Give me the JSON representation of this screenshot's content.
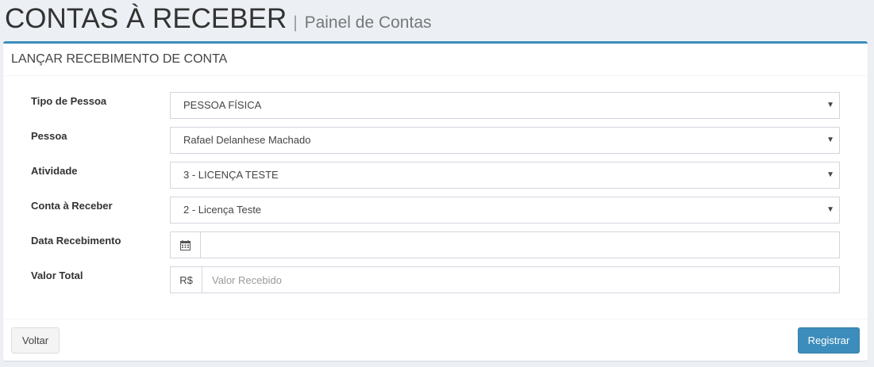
{
  "header": {
    "title": "CONTAS À RECEBER",
    "separator": "|",
    "subtitle": "Painel de Contas"
  },
  "box": {
    "title": "LANÇAR RECEBIMENTO DE CONTA"
  },
  "form": {
    "tipo_pessoa": {
      "label": "Tipo de Pessoa",
      "value": "PESSOA FÍSICA"
    },
    "pessoa": {
      "label": "Pessoa",
      "value": "Rafael Delanhese Machado"
    },
    "atividade": {
      "label": "Atividade",
      "value": "3 - LICENÇA TESTE"
    },
    "conta_receber": {
      "label": "Conta à Receber",
      "value": "2 - Licença Teste"
    },
    "data_recebimento": {
      "label": "Data Recebimento",
      "value": "",
      "addon_icon": "calendar-icon"
    },
    "valor_total": {
      "label": "Valor Total",
      "addon_text": "R$",
      "value": "",
      "placeholder": "Valor Recebido"
    },
    "caret": "▼"
  },
  "footer": {
    "back_label": "Voltar",
    "submit_label": "Registrar"
  },
  "colors": {
    "accent": "#3c8dbc",
    "background": "#ecf0f5"
  }
}
